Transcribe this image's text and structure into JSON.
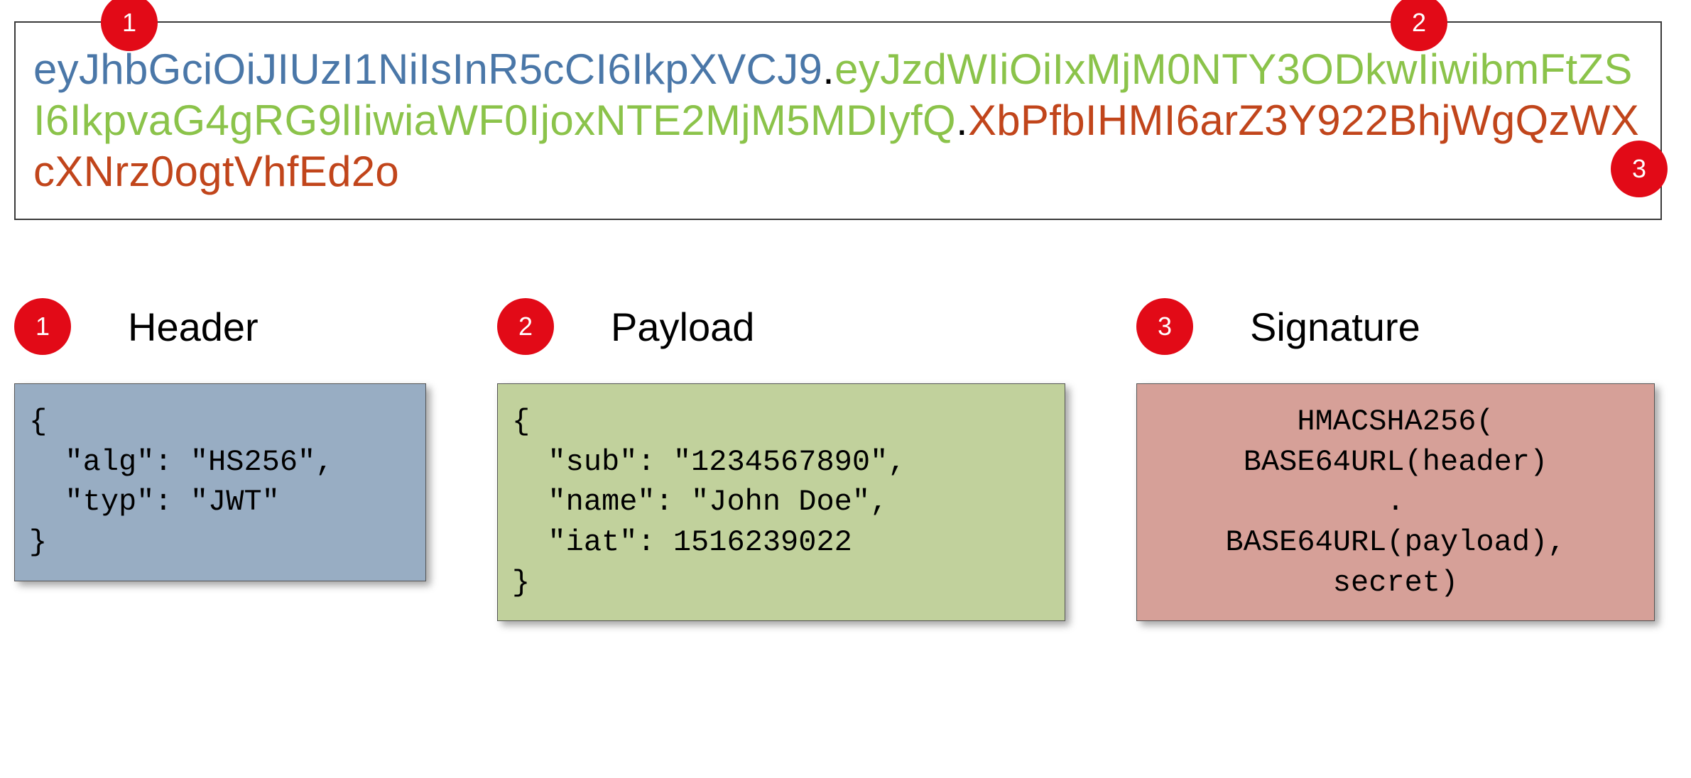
{
  "token": {
    "header": "eyJhbGciOiJIUzI1NiIsInR5cCI6IkpXVCJ9",
    "payload": "eyJzdWIiOiIxMjM0NTY3ODkwIiwibmFtZSI6IkpvaG4gRG9lIiwiaWF0IjoxNTE2MjM5MDIyfQ",
    "signature": "XbPfbIHMI6arZ3Y922BhjWgQzWXcXNrz0ogtVhfEd2o",
    "dot": "."
  },
  "badges": {
    "b1": "1",
    "b2": "2",
    "b3": "3"
  },
  "sections": [
    {
      "badge": "1",
      "title": "Header",
      "code": "{\n  \"alg\": \"HS256\",\n  \"typ\": \"JWT\"\n}",
      "boxClass": "box-header"
    },
    {
      "badge": "2",
      "title": "Payload",
      "code": "{\n  \"sub\": \"1234567890\",\n  \"name\": \"John Doe\",\n  \"iat\": 1516239022\n}",
      "boxClass": "box-payload"
    },
    {
      "badge": "3",
      "title": "Signature",
      "code": "HMACSHA256(\nBASE64URL(header)\n.\nBASE64URL(payload),\nsecret)",
      "boxClass": "box-signature"
    }
  ],
  "colors": {
    "header": "#4a77a8",
    "payload": "#8bc34a",
    "signature": "#c1451b",
    "badge": "#e20a17"
  }
}
